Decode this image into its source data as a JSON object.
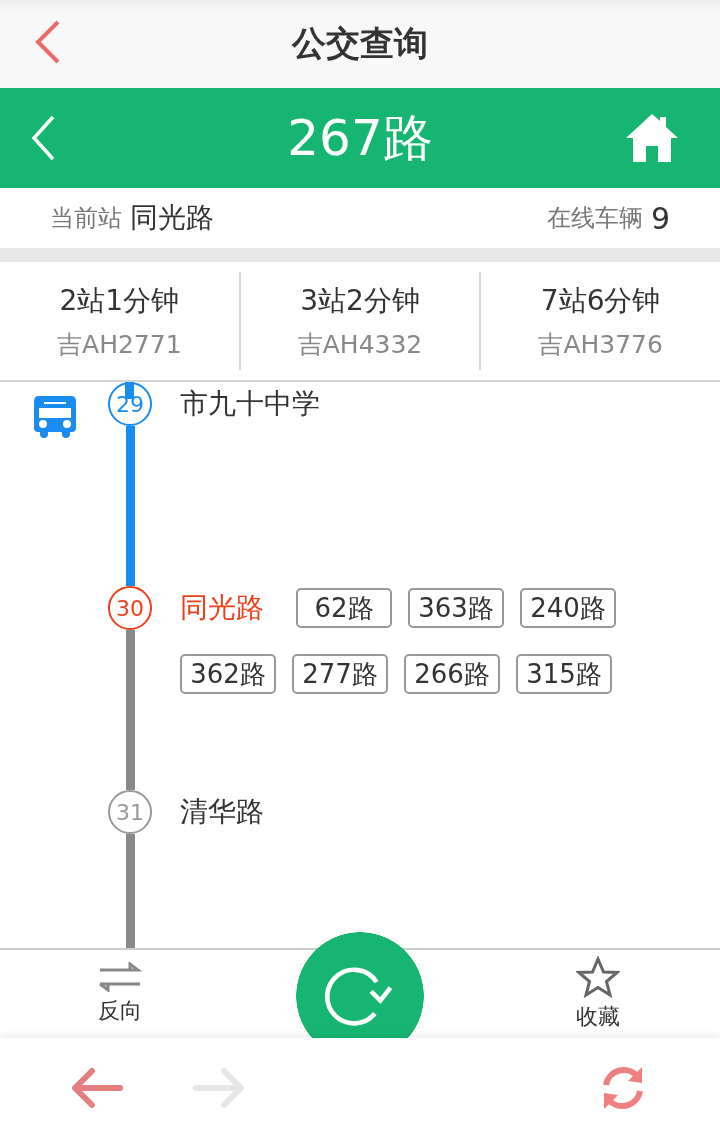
{
  "app_bar": {
    "title": "公交查询"
  },
  "route_header": {
    "title": "267路"
  },
  "current_station": {
    "label": "当前站",
    "name": "同光路",
    "online_label": "在线车辆",
    "online_count": "9"
  },
  "arrivals": [
    {
      "eta": "2站1分钟",
      "plate": "吉AH2771"
    },
    {
      "eta": "3站2分钟",
      "plate": "吉AH4332"
    },
    {
      "eta": "7站6分钟",
      "plate": "吉AH3776"
    }
  ],
  "stops": [
    {
      "number": "29",
      "name": "市九十中学",
      "passed": true,
      "current": false,
      "has_bus": true
    },
    {
      "number": "30",
      "name": "同光路",
      "passed": false,
      "current": true,
      "has_bus": false,
      "transfers": [
        "62路",
        "363路",
        "240路",
        "362路",
        "277路",
        "266路",
        "315路"
      ]
    },
    {
      "number": "31",
      "name": "清华路",
      "passed": false,
      "current": false,
      "has_bus": false
    }
  ],
  "toolbar": {
    "reverse_label": "反向",
    "favorite_label": "收藏"
  },
  "browser_bar": {
    "back_disabled": false,
    "forward_disabled": true
  }
}
